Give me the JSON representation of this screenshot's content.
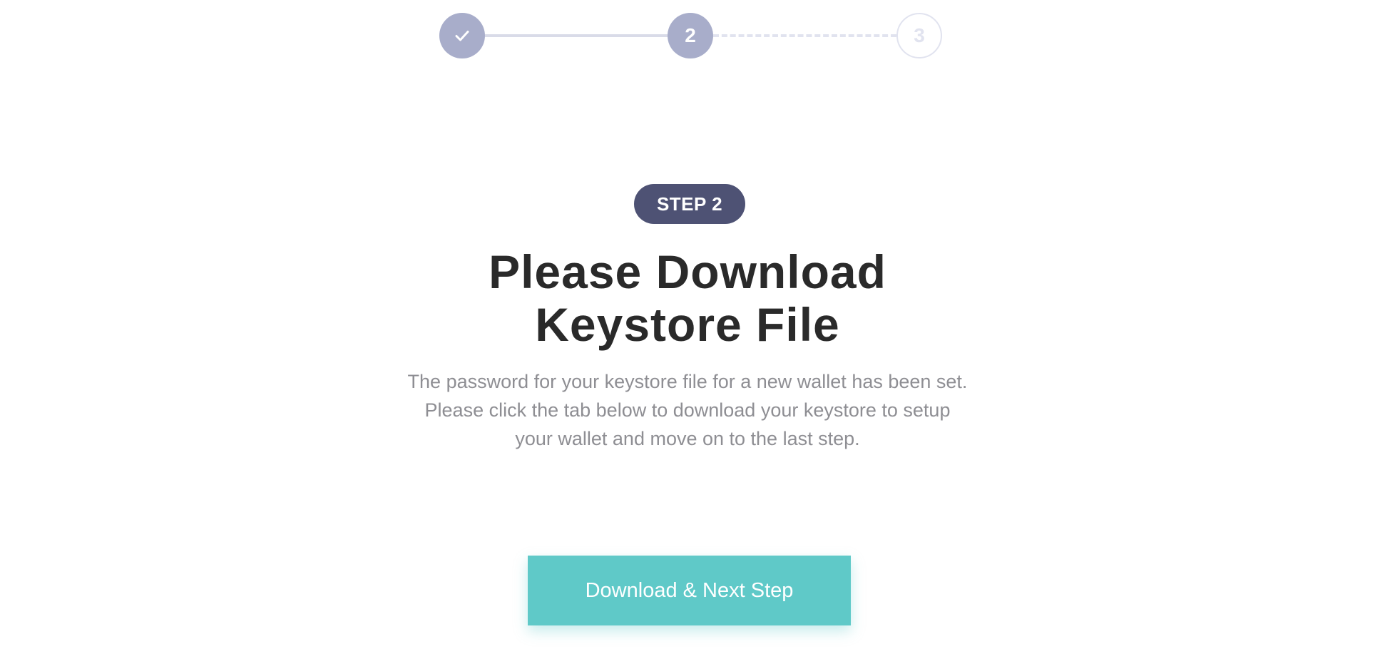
{
  "stepper": {
    "steps": [
      {
        "label": "",
        "state": "done",
        "icon": "check-icon"
      },
      {
        "label": "2",
        "state": "current"
      },
      {
        "label": "3",
        "state": "upcoming"
      }
    ]
  },
  "main": {
    "badge": "STEP 2",
    "title_line1": "Please Download",
    "title_line2": "Keystore File",
    "description_lines": [
      "The password for your keystore file for a new wallet has been set.",
      "Please click the tab below to download your keystore to setup",
      "your wallet and move on to the last step."
    ],
    "button_label": "Download & Next Step"
  },
  "colors": {
    "badge_bg": "#4e5274",
    "step_active": "#a8adca",
    "step_inactive": "#e1e3ef",
    "button_bg": "#5fc9c8",
    "title_text": "#2a2a2a",
    "body_text": "#8e8e93"
  }
}
